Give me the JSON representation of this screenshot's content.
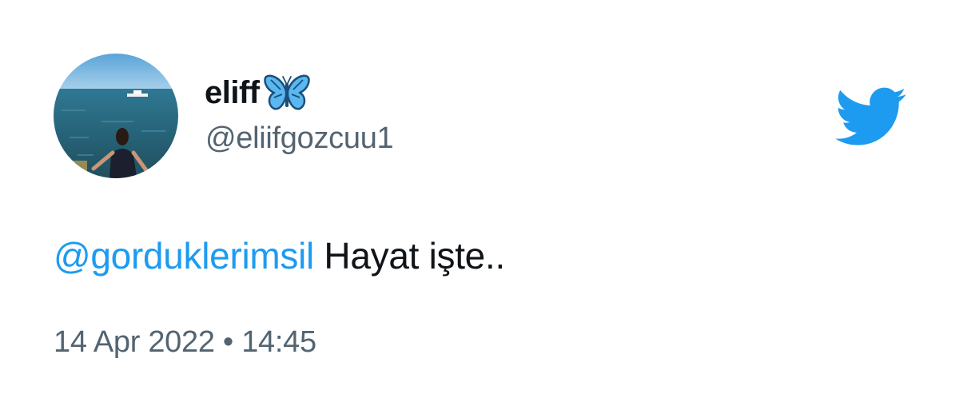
{
  "user": {
    "display_name": "eliff",
    "name_emoji": "butterfly-icon",
    "handle": "@eliifgozcuu1",
    "avatar": "profile-photo"
  },
  "tweet": {
    "mention": "@gorduklerimsil",
    "text": " Hayat işte..",
    "date": "14 Apr 2022",
    "separator": "•",
    "time": "14:45"
  },
  "brand": {
    "logo": "twitter-bird-icon",
    "accent_color": "#1d9bf0",
    "text_color": "#0f1419",
    "secondary_text_color": "#536471"
  }
}
